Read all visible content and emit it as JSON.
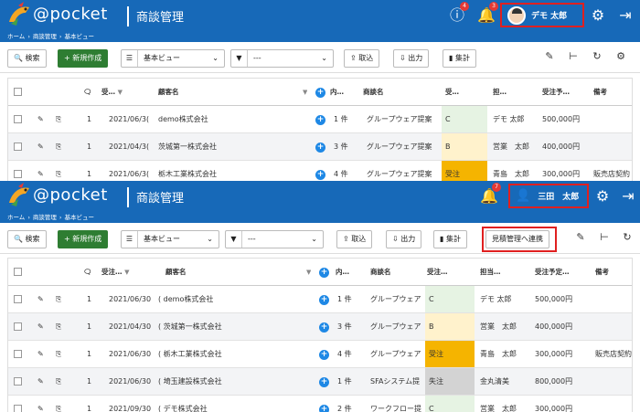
{
  "pane1": {
    "logo": "@pocket",
    "title": "商談管理",
    "breadcrumb": [
      "ホーム",
      "商談管理",
      "基本ビュー"
    ],
    "notif_warn_count": "4",
    "notif_bell_count": "3",
    "user_name": "デモ 太郎",
    "toolbar": {
      "search": "検索",
      "new": "新規作成",
      "view": "基本ビュー",
      "filter": "---",
      "import": "取込",
      "export": "出力",
      "aggregate": "集計"
    },
    "columns": {
      "date": "受…",
      "customer": "顧客名",
      "detail": "内…",
      "deal": "商談名",
      "status": "受…",
      "owner": "担…",
      "amount": "受注予…",
      "note": "備考"
    },
    "rows": [
      {
        "num": "1",
        "date": "2021/06/3(",
        "customer": "demo株式会社",
        "detail": "1 件",
        "deal": "グループウェア提案",
        "status": "C",
        "owner": "デモ 太郎",
        "amount": "500,000円",
        "note": ""
      },
      {
        "num": "1",
        "date": "2021/04/3(",
        "customer": "茨城第一株式会社",
        "detail": "3 件",
        "deal": "グループウェア提案",
        "status": "B",
        "owner": "営業　太郎",
        "amount": "400,000円",
        "note": ""
      },
      {
        "num": "1",
        "date": "2021/06/3(",
        "customer": "栃木工業株式会社",
        "detail": "4 件",
        "deal": "グループウェア提案",
        "status": "受注",
        "owner": "青島　太郎",
        "amount": "300,000円",
        "note": "販売店契約"
      }
    ]
  },
  "pane2": {
    "logo": "@pocket",
    "title": "商談管理",
    "breadcrumb": [
      "ホーム",
      "商談管理",
      "基本ビュー"
    ],
    "notif_bell_count": "7",
    "user_name": "三田　太郎",
    "toolbar": {
      "search": "検索",
      "new": "新規作成",
      "view": "基本ビュー",
      "filter": "---",
      "import": "取込",
      "export": "出力",
      "aggregate": "集計",
      "link": "見積管理へ連携"
    },
    "columns": {
      "date": "受注…",
      "customer": "顧客名",
      "detail": "内…",
      "deal": "商談名",
      "status": "受注…",
      "owner": "担当…",
      "amount": "受注予定…",
      "note": "備考"
    },
    "rows": [
      {
        "num": "1",
        "date": "2021/06/30",
        "customer": "( demo株式会社",
        "detail": "1 件",
        "deal": "グループウェア",
        "status": "C",
        "owner": "デモ 太郎",
        "amount": "500,000円",
        "note": ""
      },
      {
        "num": "1",
        "date": "2021/04/30",
        "customer": "( 茨城第一株式会社",
        "detail": "3 件",
        "deal": "グループウェア",
        "status": "B",
        "owner": "営業　太郎",
        "amount": "400,000円",
        "note": ""
      },
      {
        "num": "1",
        "date": "2021/06/30",
        "customer": "( 栃木工業株式会社",
        "detail": "4 件",
        "deal": "グループウェア",
        "status": "受注",
        "owner": "青島　太郎",
        "amount": "300,000円",
        "note": "販売店契約"
      },
      {
        "num": "1",
        "date": "2021/06/30",
        "customer": "( 埼玉建設株式会社",
        "detail": "1 件",
        "deal": "SFAシステム提",
        "status": "失注",
        "owner": "金丸清美",
        "amount": "800,000円",
        "note": ""
      },
      {
        "num": "1",
        "date": "2021/09/30",
        "customer": "( デモ株式会社",
        "detail": "2 件",
        "deal": "ワークフロー提",
        "status": "C",
        "owner": "営業　太郎",
        "amount": "300,000円",
        "note": ""
      }
    ]
  },
  "colors": {
    "header": "#1769b8",
    "accent_red": "#e02020",
    "green": "#2e7d32"
  }
}
